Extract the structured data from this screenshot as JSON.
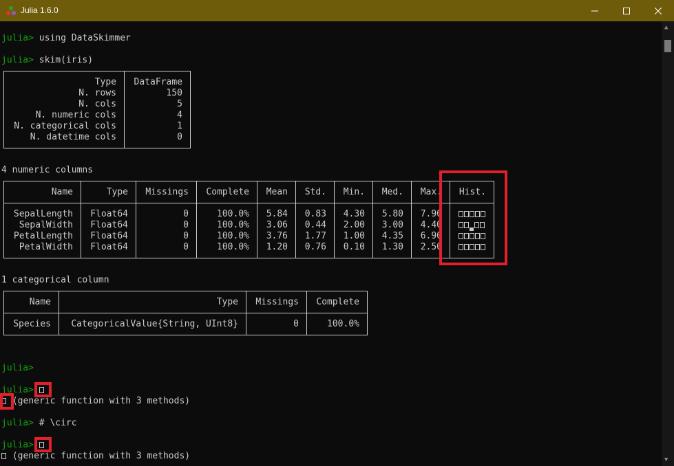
{
  "window": {
    "title": "Julia 1.6.0"
  },
  "prompt": "julia>",
  "lines": {
    "using": "using DataSkimmer",
    "skim": "skim(iris)",
    "numeric_header": "4 numeric columns",
    "categorical_header": "1 categorical column",
    "glyph_result": "(generic function with 3 methods)",
    "comment": "# \\circ",
    "glyph_result2": "(generic function with 3 methods)"
  },
  "summary_table": {
    "rows": [
      {
        "label": "Type",
        "value": "DataFrame"
      },
      {
        "label": "N. rows",
        "value": "150"
      },
      {
        "label": "N. cols",
        "value": "5"
      },
      {
        "label": "N. numeric cols",
        "value": "4"
      },
      {
        "label": "N. categorical cols",
        "value": "1"
      },
      {
        "label": "N. datetime cols",
        "value": "0"
      }
    ]
  },
  "numeric_table": {
    "headers": [
      "Name",
      "Type",
      "Missings",
      "Complete",
      "Mean",
      "Std.",
      "Min.",
      "Med.",
      "Max.",
      "Hist."
    ],
    "rows": [
      [
        "SepalLength",
        "Float64",
        "0",
        "100.0%",
        "5.84",
        "0.83",
        "4.30",
        "5.80",
        "7.90"
      ],
      [
        "SepalWidth",
        "Float64",
        "0",
        "100.0%",
        "3.06",
        "0.44",
        "2.00",
        "3.00",
        "4.40"
      ],
      [
        "PetalLength",
        "Float64",
        "0",
        "100.0%",
        "3.76",
        "1.77",
        "1.00",
        "4.35",
        "6.90"
      ],
      [
        "PetalWidth",
        "Float64",
        "0",
        "100.0%",
        "1.20",
        "0.76",
        "0.10",
        "1.30",
        "2.50"
      ]
    ]
  },
  "categorical_table": {
    "headers": [
      "Name",
      "Type",
      "Missings",
      "Complete"
    ],
    "rows": [
      [
        "Species",
        "CategoricalValue{String, UInt8}",
        "0",
        "100.0%"
      ]
    ]
  },
  "colors": {
    "titlebar": "#6e5c0a",
    "prompt": "#13a10e",
    "highlight": "#e0202a",
    "text": "#cccccc",
    "background": "#0c0c0c"
  },
  "icons": [
    "julia-logo-icon",
    "minimize-icon",
    "maximize-icon",
    "close-icon",
    "missing-glyph-icon"
  ]
}
